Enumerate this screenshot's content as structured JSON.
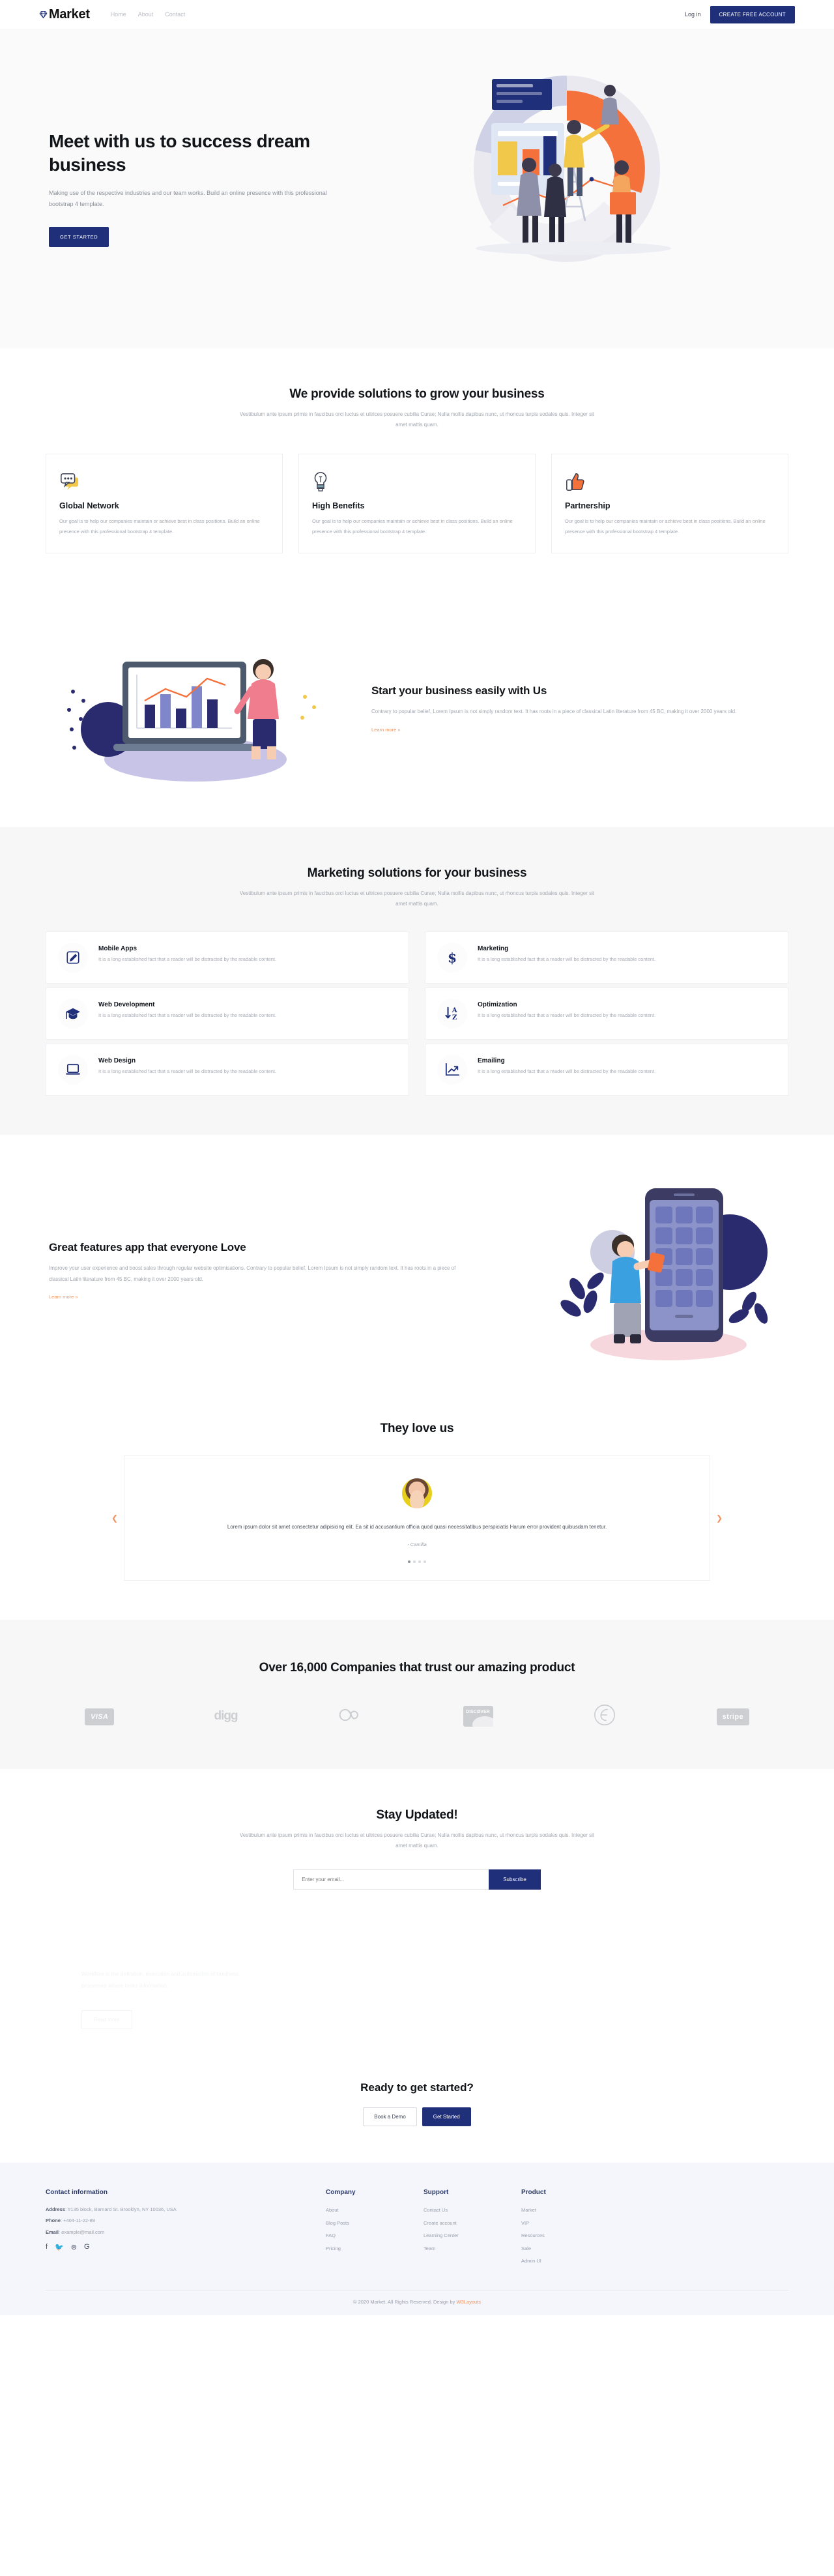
{
  "header": {
    "brand": "Market",
    "nav": [
      {
        "label": "Home"
      },
      {
        "label": "About"
      },
      {
        "label": "Contact"
      }
    ],
    "login_label": "Log in",
    "cta_label": "CREATE FREE ACCOUNT"
  },
  "hero": {
    "title": "Meet with us to success dream business",
    "paragraph": "Making use of the respective industries and our team works. Build an online presence with this professional bootstrap 4 template.",
    "button": "GET STARTED"
  },
  "solutions": {
    "title": "We provide solutions to grow your business",
    "subtitle": "Vestibulum ante ipsum primis in faucibus orci luctus et ultrices posuere cubilia Curae; Nulla mollis dapibus nunc, ut rhoncus turpis sodales quis. Integer sit amet mattis quam.",
    "cards": [
      {
        "icon": "chat-bubble-icon",
        "title": "Global Network",
        "text": "Our goal is to help our companies maintain or achieve best in class positions. Build an online presence with this professional bootstrap 4 template."
      },
      {
        "icon": "lightbulb-icon",
        "title": "High Benefits",
        "text": "Our goal is to help our companies maintain or achieve best in class positions. Build an online presence with this professional bootstrap 4 template."
      },
      {
        "icon": "thumbs-up-icon",
        "title": "Partnership",
        "text": "Our goal is to help our companies maintain or achieve best in class positions. Build an online presence with this professional bootstrap 4 template."
      }
    ]
  },
  "start_business": {
    "title": "Start your business easily with Us",
    "text": "Contrary to popular belief, Lorem Ipsum is not simply random text. It has roots in a piece of classical Latin literature from 45 BC, making it over 2000 years old.",
    "link": "Learn more »"
  },
  "marketing": {
    "title": "Marketing solutions for your business",
    "subtitle": "Vestibulum ante ipsum primis in faucibus orci luctus et ultrices posuere cubilia Curae; Nulla mollis dapibus nunc, ut rhoncus turpis sodales quis. Integer sit amet mattis quam.",
    "services": [
      {
        "icon": "pencil-square-icon",
        "title": "Mobile Apps",
        "text": "It is a long established fact that a reader will be distracted by the readable content."
      },
      {
        "icon": "dollar-sign-icon",
        "title": "Marketing",
        "text": "It is a long established fact that a reader will be distracted by the readable content."
      },
      {
        "icon": "graduation-cap-icon",
        "title": "Web Development",
        "text": "It is a long established fact that a reader will be distracted by the readable content."
      },
      {
        "icon": "sort-alpha-down-icon",
        "title": "Optimization",
        "text": "It is a long established fact that a reader will be distracted by the readable content."
      },
      {
        "icon": "laptop-icon",
        "title": "Web Design",
        "text": "It is a long established fact that a reader will be distracted by the readable content."
      },
      {
        "icon": "chart-line-icon",
        "title": "Emailing",
        "text": "It is a long established fact that a reader will be distracted by the readable content."
      }
    ]
  },
  "features_app": {
    "title": "Great features app that everyone Love",
    "text": "Improve your user experience and boost sales through regular website optimisations. Contrary to popular belief, Lorem Ipsum is not simply random text. It has roots in a piece of classical Latin literature from 45 BC, making it over 2000 years old.",
    "link": "Learn more »"
  },
  "testimonial": {
    "title": "They love us",
    "quote": "Lorem ipsum dolor sit amet consectetur adipisicing elit. Ea sit id accusantium officia quod quasi necessitatibus perspiciatis Harum error provident quibusdam tenetur.",
    "author": "- Camilla",
    "prev_icon": "chevron-left-icon",
    "next_icon": "chevron-right-icon",
    "dots": 4,
    "active_dot": 0
  },
  "brands": {
    "title": "Over 16,000 Companies that trust our amazing product",
    "logos": [
      {
        "name": "visa-logo",
        "label": "VISA"
      },
      {
        "name": "digg-logo",
        "label": "digg"
      },
      {
        "name": "lastfm-logo",
        "label": "as"
      },
      {
        "name": "discover-logo",
        "label": "DISCØVER"
      },
      {
        "name": "creative-logo",
        "label": "e"
      },
      {
        "name": "stripe-logo",
        "label": "stripe"
      }
    ]
  },
  "newsletter": {
    "title": "Stay Updated!",
    "subtitle": "Vestibulum ante ipsum primis in faucibus orci luctus et ultrices posuere cubilia Curae; Nulla mollis dapibus nunc, ut rhoncus turpis sodales quis. Integer sit amet mattis quam.",
    "placeholder": "Enter your email...",
    "value": "",
    "button": "Subscribe"
  },
  "workflow": {
    "text": "Workflow is the definition, execution and automation of business processes where tasks information.",
    "button": "Read more"
  },
  "cta": {
    "title": "Ready to get started?",
    "demo_label": "Book a Demo",
    "start_label": "Get Started"
  },
  "footer": {
    "contact": {
      "title": "Contact information",
      "address_label": "Address",
      "address_value": ": #135 block, Barnard St. Brooklyn, NY 10036, USA",
      "phone_label": "Phone",
      "phone_value": ": +404-11-22-89",
      "email_label": "Email",
      "email_value": ": example@mail.com",
      "socials": [
        {
          "name": "facebook-icon",
          "glyph": "f"
        },
        {
          "name": "twitter-icon",
          "glyph": "🐦"
        },
        {
          "name": "dribbble-icon",
          "glyph": "⊛"
        },
        {
          "name": "google-icon",
          "glyph": "G"
        }
      ]
    },
    "columns": [
      {
        "title": "Company",
        "links": [
          "About",
          "Blog Posts",
          "FAQ",
          "Pricing"
        ]
      },
      {
        "title": "Support",
        "links": [
          "Contact Us",
          "Create account",
          "Learning Center",
          "Team"
        ]
      },
      {
        "title": "Product",
        "links": [
          "Market",
          "VIP",
          "Resources",
          "Sale",
          "Admin UI"
        ]
      }
    ],
    "copyright_prefix": "© 2020 Market. All Rights Reserved. Design by ",
    "copyright_link": "W3Layouts"
  },
  "colors": {
    "primary": "#1f2f7a",
    "accent": "#f0915e",
    "orange": "#f4713c",
    "yellow": "#f2c84b",
    "gray_bg": "#f7f7f8",
    "footer_bg": "#f4f6fb"
  }
}
